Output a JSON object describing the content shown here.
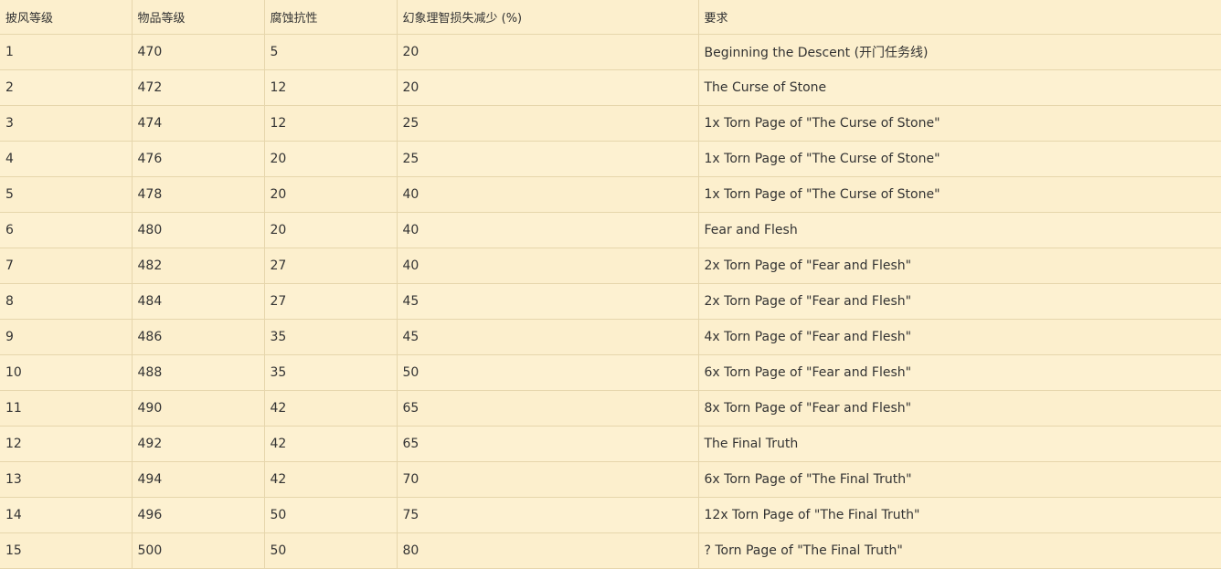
{
  "table": {
    "headers": [
      "披风等级",
      "物品等级",
      "腐蚀抗性",
      "幻象理智损失减少 (%)",
      "要求"
    ],
    "rows": [
      [
        "1",
        "470",
        "5",
        "20",
        "Beginning the Descent (开门任务线)"
      ],
      [
        "2",
        "472",
        "12",
        "20",
        "The Curse of Stone"
      ],
      [
        "3",
        "474",
        "12",
        "25",
        "1x Torn Page of \"The Curse of Stone\""
      ],
      [
        "4",
        "476",
        "20",
        "25",
        "1x Torn Page of \"The Curse of Stone\""
      ],
      [
        "5",
        "478",
        "20",
        "40",
        "1x Torn Page of \"The Curse of Stone\""
      ],
      [
        "6",
        "480",
        "20",
        "40",
        "Fear and Flesh"
      ],
      [
        "7",
        "482",
        "27",
        "40",
        "2x Torn Page of \"Fear and Flesh\""
      ],
      [
        "8",
        "484",
        "27",
        "45",
        "2x Torn Page of \"Fear and Flesh\""
      ],
      [
        "9",
        "486",
        "35",
        "45",
        "4x Torn Page of \"Fear and Flesh\""
      ],
      [
        "10",
        "488",
        "35",
        "50",
        "6x Torn Page of \"Fear and Flesh\""
      ],
      [
        "11",
        "490",
        "42",
        "65",
        "8x Torn Page of \"Fear and Flesh\""
      ],
      [
        "12",
        "492",
        "42",
        "65",
        "The Final Truth"
      ],
      [
        "13",
        "494",
        "42",
        "70",
        "6x Torn Page of \"The Final Truth\""
      ],
      [
        "14",
        "496",
        "50",
        "75",
        "12x Torn Page of \"The Final Truth\""
      ],
      [
        "15",
        "500",
        "50",
        "80",
        "? Torn Page of \"The Final Truth\""
      ]
    ]
  }
}
